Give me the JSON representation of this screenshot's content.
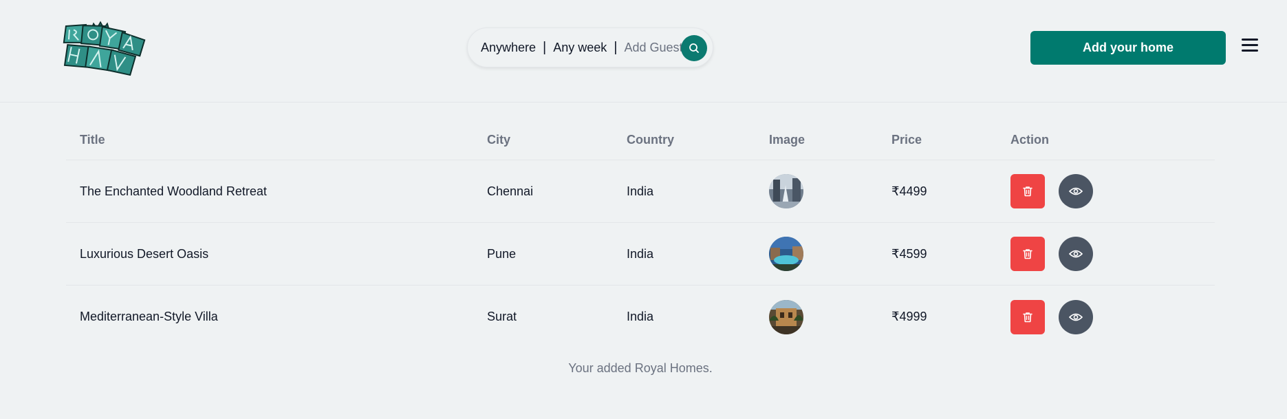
{
  "header": {
    "search": {
      "location": "Anywhere",
      "separator": "|",
      "dates": "Any week",
      "guests": "Add Guest"
    },
    "add_home_label": "Add your home"
  },
  "table": {
    "columns": [
      "Title",
      "City",
      "Country",
      "Image",
      "Price",
      "Action"
    ],
    "rows": [
      {
        "title": "The Enchanted Woodland Retreat",
        "city": "Chennai",
        "country": "India",
        "price": "₹4499"
      },
      {
        "title": "Luxurious Desert Oasis",
        "city": "Pune",
        "country": "India",
        "price": "₹4599"
      },
      {
        "title": "Mediterranean-Style Villa",
        "city": "Surat",
        "country": "India",
        "price": "₹4999"
      }
    ]
  },
  "caption": "Your added Royal Homes.",
  "icons": {
    "logo": "royal-haven-logo",
    "search": "search-icon",
    "menu": "hamburger-menu-icon",
    "delete": "trash-icon",
    "view": "eye-icon"
  },
  "colors": {
    "background": "#eff2f3",
    "brand": "#007a6e",
    "delete": "#ef4444",
    "view": "#4b5563"
  }
}
